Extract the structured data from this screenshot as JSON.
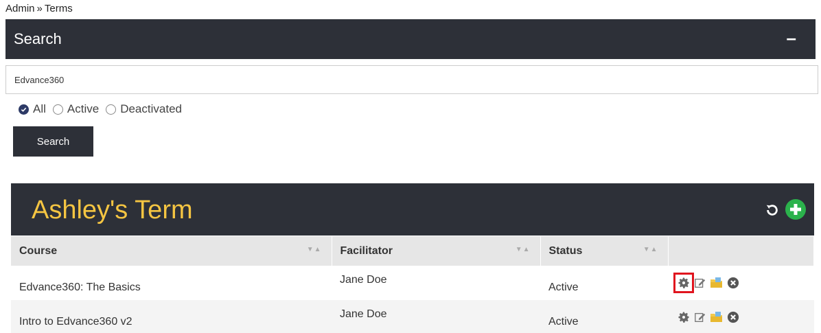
{
  "breadcrumb": {
    "root": "Admin",
    "separator": "»",
    "current": "Terms"
  },
  "search_panel": {
    "title": "Search",
    "collapse_label": "–"
  },
  "search": {
    "value": "Edvance360",
    "placeholder": ""
  },
  "filters": {
    "selected": "All",
    "options": [
      {
        "label": "All"
      },
      {
        "label": "Active"
      },
      {
        "label": "Deactivated"
      }
    ]
  },
  "search_button_label": "Search",
  "term": {
    "title": "Ashley's Term",
    "refresh_icon": "refresh-icon",
    "add_icon": "add-icon"
  },
  "table": {
    "columns": [
      "Course",
      "Facilitator",
      "Status",
      ""
    ],
    "rows": [
      {
        "course": "Edvance360: The Basics",
        "facilitator": "Jane Doe",
        "status": "Active"
      },
      {
        "course": "Intro to Edvance360 v2",
        "facilitator": "Jane Doe",
        "status": "Active"
      }
    ],
    "row_action_icons": [
      "gear-icon",
      "edit-icon",
      "folder-icon",
      "delete-icon"
    ]
  },
  "colors": {
    "panel_bg": "#2d3038",
    "term_title": "#f5c542",
    "add_button": "#2bb24c",
    "highlight": "#e0141e"
  }
}
